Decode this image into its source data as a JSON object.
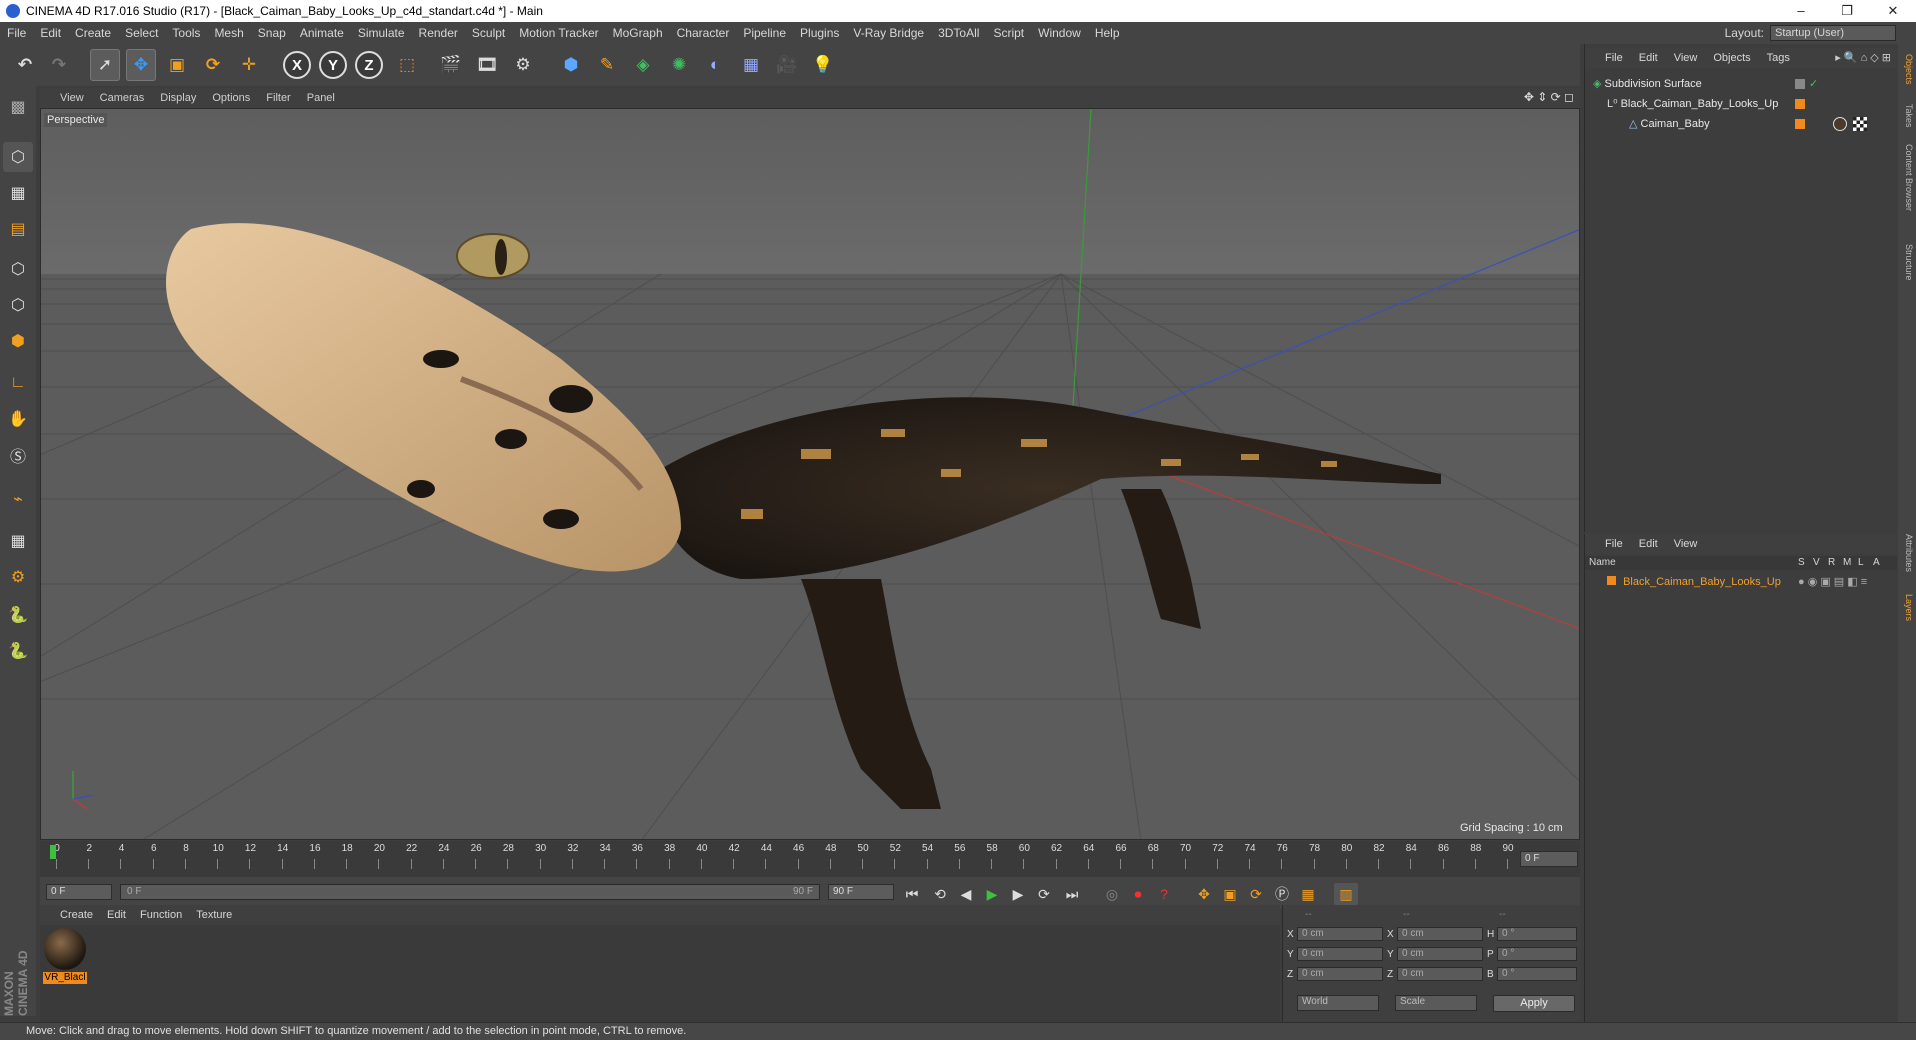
{
  "window": {
    "title": "CINEMA 4D R17.016 Studio (R17) - [Black_Caiman_Baby_Looks_Up_c4d_standart.c4d *] - Main",
    "controls": [
      "–",
      "❐",
      "✕"
    ]
  },
  "menubar": {
    "items": [
      "File",
      "Edit",
      "Create",
      "Select",
      "Tools",
      "Mesh",
      "Snap",
      "Animate",
      "Simulate",
      "Render",
      "Sculpt",
      "Motion Tracker",
      "MoGraph",
      "Character",
      "Pipeline",
      "Plugins",
      "V-Ray Bridge",
      "3DToAll",
      "Script",
      "Window",
      "Help"
    ],
    "layout_label": "Layout:",
    "layout_value": "Startup (User)"
  },
  "toolbar": {
    "icons": [
      "undo-icon",
      "redo-icon",
      "select-icon",
      "move-icon",
      "scale-icon",
      "rotate-icon",
      "transform-icon",
      "x-axis-icon",
      "y-axis-icon",
      "z-axis-icon",
      "coord-system-icon",
      "render-view-icon",
      "render-picture-queue-icon",
      "render-settings-icon",
      "cube-icon",
      "pen-icon",
      "subdivision-icon",
      "array-icon",
      "deformer-icon",
      "floor-icon",
      "camera-icon",
      "light-icon"
    ],
    "axis_labels": [
      "X",
      "Y",
      "Z"
    ]
  },
  "viewport": {
    "menu": [
      "View",
      "Cameras",
      "Display",
      "Options",
      "Filter",
      "Panel"
    ],
    "label": "Perspective",
    "grid_spacing": "Grid Spacing : 10 cm"
  },
  "timeline": {
    "ticks": [
      "0",
      "2",
      "4",
      "6",
      "8",
      "10",
      "12",
      "14",
      "16",
      "18",
      "20",
      "22",
      "24",
      "26",
      "28",
      "30",
      "32",
      "34",
      "36",
      "38",
      "40",
      "42",
      "44",
      "46",
      "48",
      "50",
      "52",
      "54",
      "56",
      "58",
      "60",
      "62",
      "64",
      "66",
      "68",
      "70",
      "72",
      "74",
      "76",
      "78",
      "80",
      "82",
      "84",
      "86",
      "88",
      "90"
    ],
    "current_frame": "0 F",
    "start_field": "0 F",
    "range_start": "0 F",
    "range_end": "90 F",
    "end_field": "90 F"
  },
  "materials": {
    "menu": [
      "Create",
      "Edit",
      "Function",
      "Texture"
    ],
    "items": [
      {
        "label": "VR_Blacl"
      }
    ]
  },
  "coords": {
    "headers": [
      "--",
      "--",
      "--"
    ],
    "rows": [
      {
        "a": "X",
        "av": "0 cm",
        "b": "X",
        "bv": "0 cm",
        "c": "H",
        "cv": "0 °"
      },
      {
        "a": "Y",
        "av": "0 cm",
        "b": "Y",
        "bv": "0 cm",
        "c": "P",
        "cv": "0 °"
      },
      {
        "a": "Z",
        "av": "0 cm",
        "b": "Z",
        "bv": "0 cm",
        "c": "B",
        "cv": "0 °"
      }
    ],
    "world": "World",
    "scale": "Scale",
    "apply": "Apply"
  },
  "objects": {
    "menu": [
      "File",
      "Edit",
      "View",
      "Objects",
      "Tags"
    ],
    "rows": [
      {
        "name": "Subdivision Surface",
        "indent": 0
      },
      {
        "name": "Black_Caiman_Baby_Looks_Up",
        "indent": 1
      },
      {
        "name": "Caiman_Baby",
        "indent": 2
      }
    ]
  },
  "layers": {
    "menu": [
      "File",
      "Edit",
      "View"
    ],
    "name_header": "Name",
    "col_headers": [
      "S",
      "V",
      "R",
      "M",
      "L",
      "A"
    ],
    "rows": [
      {
        "name": "Black_Caiman_Baby_Looks_Up"
      }
    ]
  },
  "side_tabs": [
    "Objects",
    "Takes",
    "Content Browser",
    "Structure",
    "Attributes",
    "Layers"
  ],
  "status": "Move: Click and drag to move elements. Hold down SHIFT to quantize movement / add to the selection in point mode, CTRL to remove.",
  "brand": [
    "MAXON",
    "CINEMA 4D"
  ],
  "colors": {
    "accent": "#f08a1c",
    "layer_text": "#f0a030",
    "play": "#3fbf3f"
  }
}
